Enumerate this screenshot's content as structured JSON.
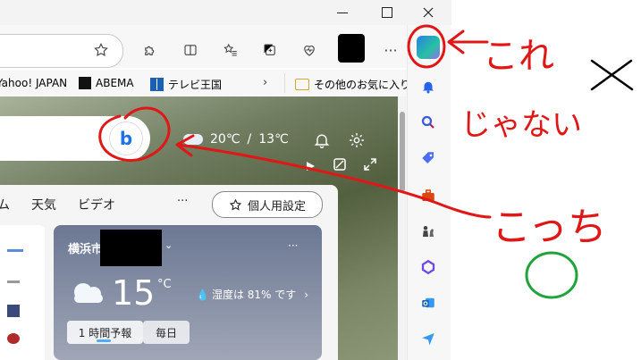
{
  "window": {
    "minimize_icon": "minimize-icon",
    "maximize_icon": "maximize-icon",
    "close_icon": "close-icon"
  },
  "favorites": [
    {
      "label": "Yahoo! JAPAN"
    },
    {
      "label": "ABEMA"
    },
    {
      "label": "テレビ王国"
    },
    {
      "label": "その他のお気に入り"
    }
  ],
  "weather_top": {
    "temp_high": "20℃",
    "separator": "/",
    "temp_low": "13℃"
  },
  "nav": {
    "tabs": [
      "ム",
      "天気",
      "ビデオ"
    ],
    "more": "···",
    "personal_settings": "個人用設定"
  },
  "weather_card": {
    "city": "横浜市",
    "menu": "···",
    "temperature": "15",
    "unit": "°C",
    "humidity": "湿度は 81% です",
    "tabs": [
      "1 時間予報",
      "毎日"
    ]
  },
  "annotations": {
    "this": "これ",
    "not_this": "じゃない",
    "that_one": "こっち",
    "cross": "×"
  },
  "colors": {
    "annotation": "#e01717",
    "green_circle": "#1fa33a",
    "copilot_blue": "#1a73e8"
  }
}
